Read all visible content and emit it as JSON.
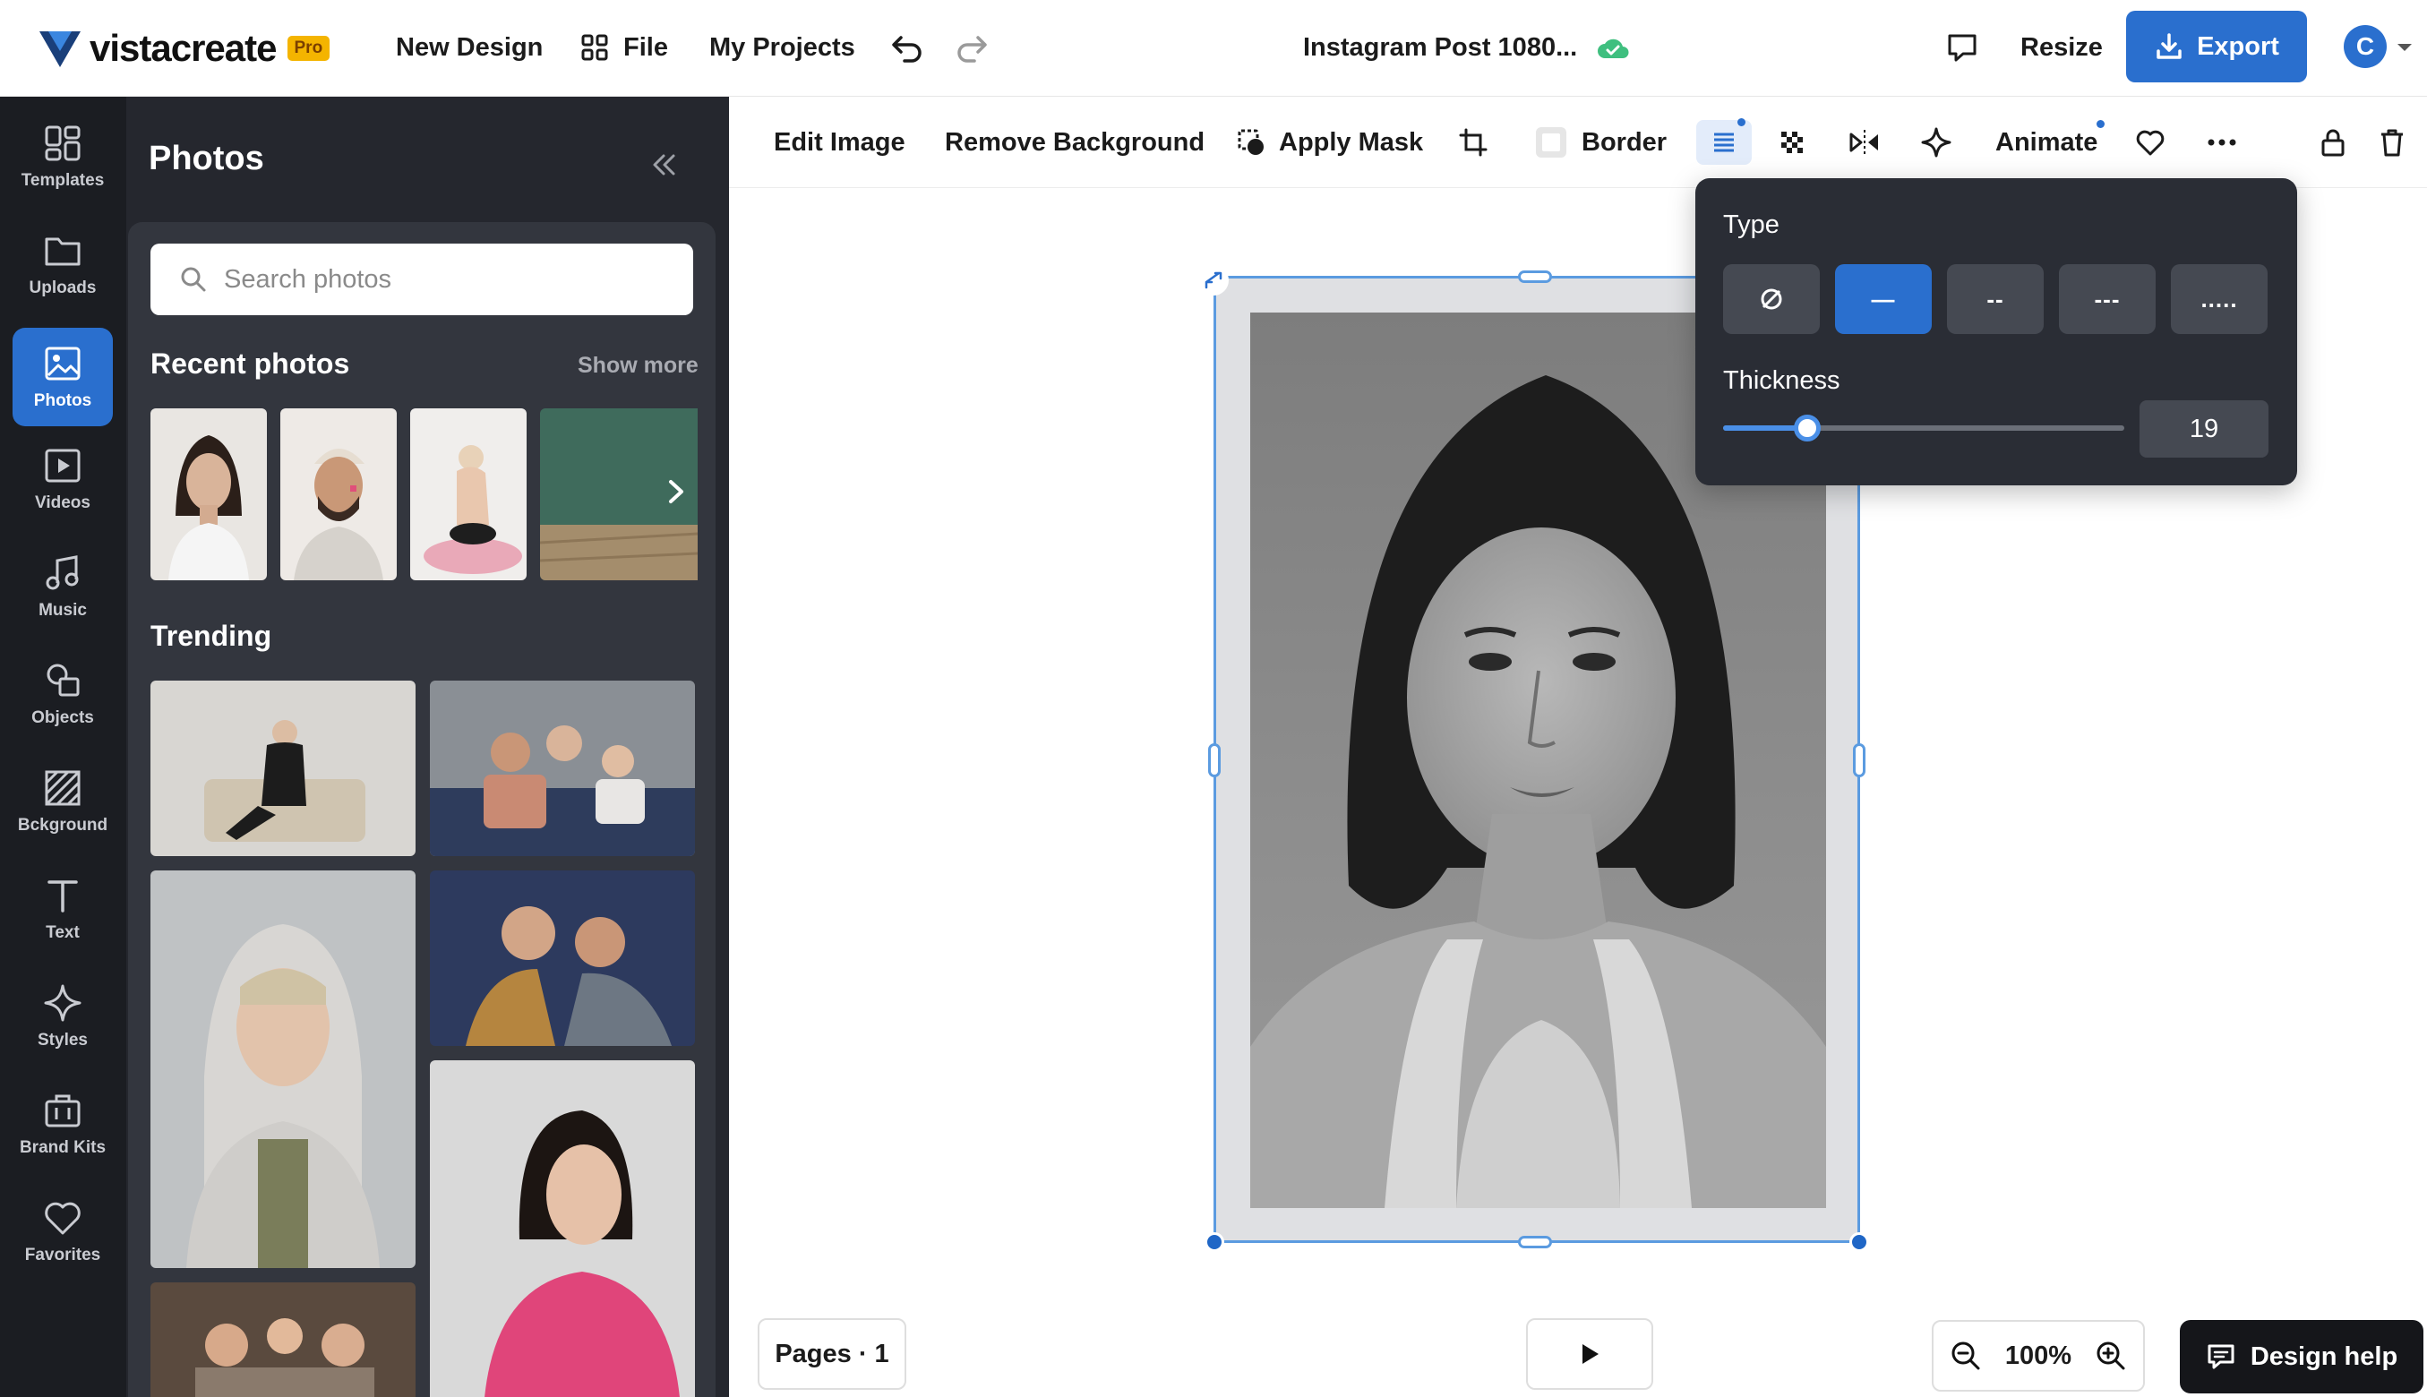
{
  "topbar": {
    "logo_text": "vistacreate",
    "pro_badge": "Pro",
    "new_design": "New Design",
    "file": "File",
    "my_projects": "My Projects",
    "doc_title": "Instagram Post 1080...",
    "resize": "Resize",
    "export": "Export",
    "avatar_initial": "C"
  },
  "rail": {
    "items": [
      {
        "label": "Templates",
        "icon": "templates-icon"
      },
      {
        "label": "Uploads",
        "icon": "folder-icon"
      },
      {
        "label": "Photos",
        "icon": "image-icon",
        "active": true
      },
      {
        "label": "Videos",
        "icon": "video-icon"
      },
      {
        "label": "Music",
        "icon": "music-icon"
      },
      {
        "label": "Objects",
        "icon": "shapes-icon"
      },
      {
        "label": "Bckground",
        "icon": "background-icon"
      },
      {
        "label": "Text",
        "icon": "text-icon"
      },
      {
        "label": "Styles",
        "icon": "sparkle-icon"
      },
      {
        "label": "Brand Kits",
        "icon": "briefcase-icon"
      },
      {
        "label": "Favorites",
        "icon": "heart-icon"
      }
    ]
  },
  "panel": {
    "title": "Photos",
    "search_placeholder": "Search photos",
    "recent_title": "Recent photos",
    "show_more": "Show more",
    "trending_title": "Trending"
  },
  "toolbar": {
    "edit_image": "Edit Image",
    "remove_background": "Remove Background",
    "apply_mask": "Apply Mask",
    "border": "Border",
    "animate": "Animate"
  },
  "popover": {
    "type_label": "Type",
    "type_options": [
      "none",
      "—",
      "--",
      "---",
      "....."
    ],
    "selected_type": "—",
    "thickness_label": "Thickness",
    "thickness_value": "19",
    "thickness_fraction": 0.21
  },
  "bottom": {
    "pages": "Pages · 1",
    "zoom": "100%",
    "design_help": "Design help"
  },
  "colors": {
    "accent": "#2a6fce",
    "rail_bg": "#1b1d22",
    "panel_bg": "#25272e",
    "popover_bg": "#2a2d35"
  }
}
